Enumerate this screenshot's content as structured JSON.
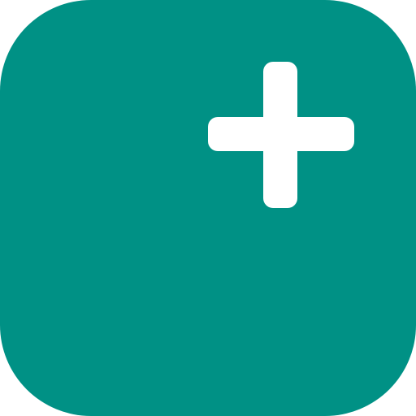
{
  "app_icon": {
    "name": "add-app-icon",
    "background_color": "#009185",
    "glyph": "plus-icon",
    "glyph_color": "#ffffff"
  }
}
